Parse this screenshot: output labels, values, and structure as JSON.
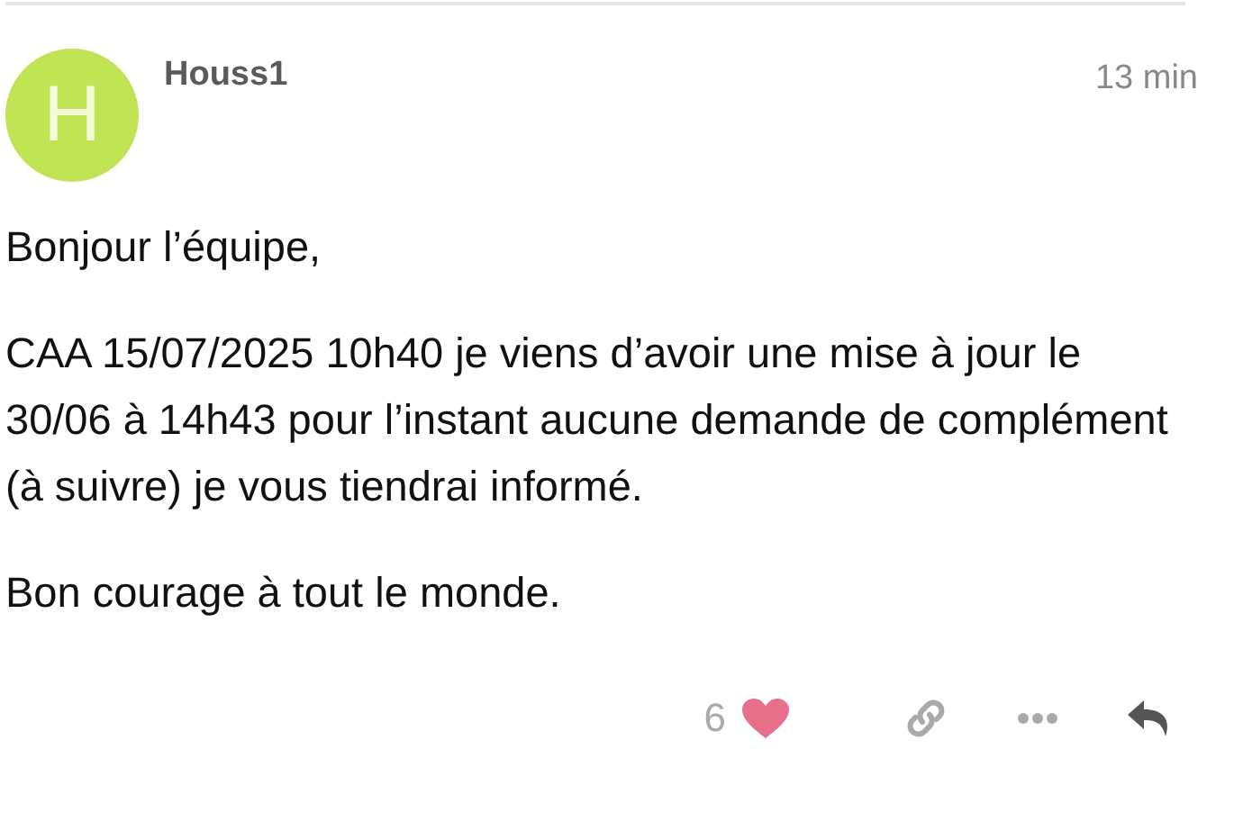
{
  "post": {
    "avatar_letter": "H",
    "username": "Houss1",
    "time": "13 min",
    "paragraphs": [
      "Bonjour l’équipe,",
      "CAA 15/07/2025 10h40 je viens d’avoir une mise à jour le 30/06 à 14h43 pour l’instant aucune demande de complément (à suivre) je vous tiendrai informé.",
      "Bon courage à tout le monde."
    ],
    "likes": {
      "count": "6",
      "liked": true
    }
  }
}
